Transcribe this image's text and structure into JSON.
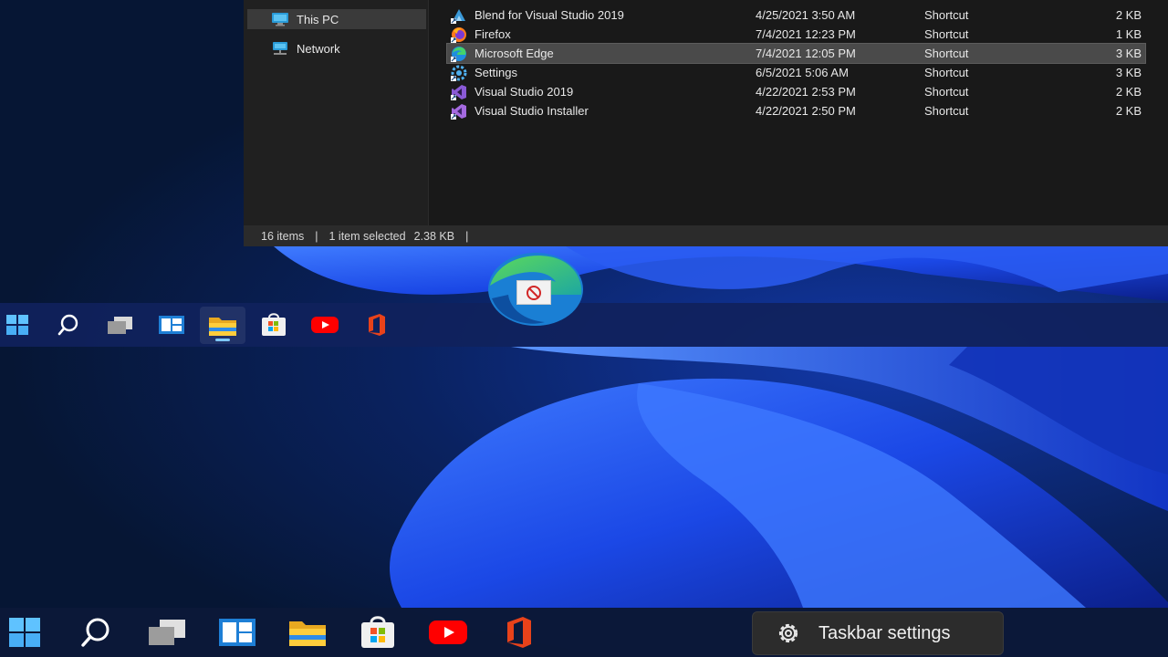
{
  "navigation": {
    "items": [
      {
        "label": "This PC",
        "icon": "computer-icon",
        "selected": true
      },
      {
        "label": "Network",
        "icon": "network-icon",
        "selected": false
      }
    ]
  },
  "files": [
    {
      "name": "Blend for Visual Studio 2019",
      "date": "4/25/2021 3:50 AM",
      "type": "Shortcut",
      "size": "2 KB",
      "icon": "blend-icon"
    },
    {
      "name": "Firefox",
      "date": "7/4/2021 12:23 PM",
      "type": "Shortcut",
      "size": "1 KB",
      "icon": "firefox-icon"
    },
    {
      "name": "Microsoft Edge",
      "date": "7/4/2021 12:05 PM",
      "type": "Shortcut",
      "size": "3 KB",
      "icon": "edge-icon",
      "selected": true
    },
    {
      "name": "Settings",
      "date": "6/5/2021 5:06 AM",
      "type": "Shortcut",
      "size": "3 KB",
      "icon": "settings-icon"
    },
    {
      "name": "Visual Studio 2019",
      "date": "4/22/2021 2:53 PM",
      "type": "Shortcut",
      "size": "2 KB",
      "icon": "visual-studio-icon"
    },
    {
      "name": "Visual Studio Installer",
      "date": "4/22/2021 2:50 PM",
      "type": "Shortcut",
      "size": "2 KB",
      "icon": "visual-studio-installer-icon"
    }
  ],
  "status": {
    "count": "16 items",
    "selection": "1 item selected",
    "size": "2.38 KB",
    "separator": "|"
  },
  "taskbar": {
    "apps": [
      "start-icon",
      "search-icon",
      "task-view-icon",
      "widgets-icon",
      "file-explorer-icon",
      "microsoft-store-icon",
      "youtube-icon",
      "office-icon"
    ],
    "active_app": "file-explorer-icon"
  },
  "context_menu": {
    "label": "Taskbar settings",
    "icon": "gear-icon"
  },
  "colors": {
    "accent": "#7ec8ff",
    "explorer_bg": "#191919",
    "wallpaper_blue": "#1f5cff"
  }
}
